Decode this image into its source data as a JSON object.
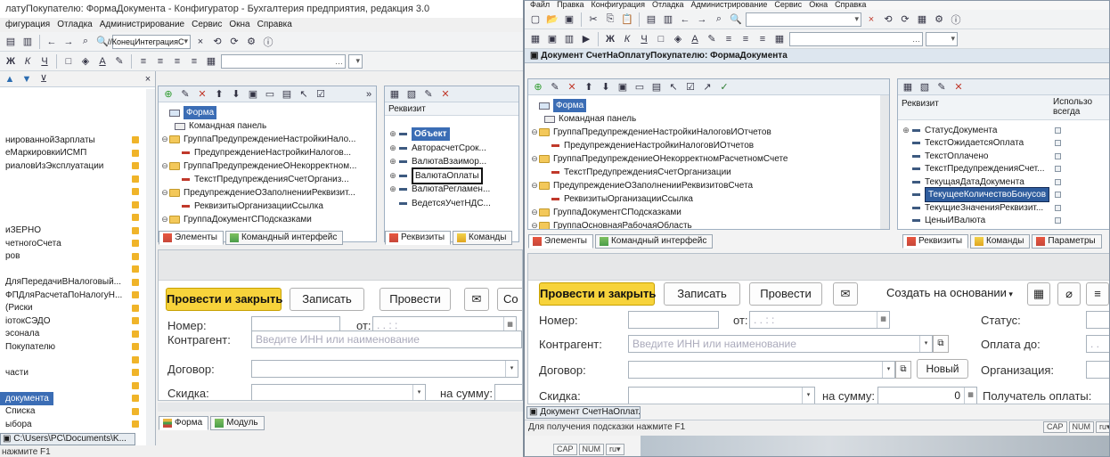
{
  "left_window": {
    "title": "латуПокупателю: ФормаДокумента - Конфигуратор - Бухгалтерия предприятия, редакция 3.0",
    "menu": [
      "фигурация",
      "Отладка",
      "Администрирование",
      "Сервис",
      "Окна",
      "Справка"
    ],
    "toolbar_combo": "//КонецИнтеграцияС",
    "sidebar_items": [
      "нированнойЗарплаты",
      "еМаркировкиИСМП",
      "риаловИзЭксплуатации",
      "",
      "",
      "",
      "",
      "иЗЕРНО",
      "четногоСчета",
      "ров",
      "",
      "ДляПередачиВНалоговый...",
      "ФПДляРасчетаПоНалогуН...",
      "(Риски",
      "іотокСЭДО",
      "эсонала",
      "Покупателю",
      "",
      "части",
      "",
      "документа",
      "Списка",
      "ыбора"
    ],
    "taskbar_path": "C:\\Users\\PC\\Documents\\K...",
    "status": "нажмите F1"
  },
  "left_editor": {
    "tree": [
      {
        "label": "Форма",
        "kind": "form",
        "sel": true
      },
      {
        "label": "Командная панель",
        "kind": "cmd"
      },
      {
        "label": "ГруппаПредупреждениеНастройкиНало...",
        "kind": "folder"
      },
      {
        "label": "ПредупреждениеНастройкиНалогов...",
        "kind": "item"
      },
      {
        "label": "ГруппаПредупреждениеОНекорректном...",
        "kind": "folder"
      },
      {
        "label": "ТекстПредупрежденияСчетОрганиз...",
        "kind": "item"
      },
      {
        "label": "ПредупреждениеОЗаполненииРеквизит...",
        "kind": "folder"
      },
      {
        "label": "РеквизитыОрганизацииСсылка",
        "kind": "item"
      },
      {
        "label": "ГруппаДокументСПодсказками",
        "kind": "folder"
      }
    ],
    "tabs": [
      "Элементы",
      "Командный интерфейс"
    ],
    "attrs_header": "Реквизит",
    "attrs": [
      "Объект",
      "АвторасчетСрок...",
      "ВалютаВзаимор...",
      "ВалютаОплаты",
      "ВалютаРегламен...",
      "ВедетсяУчетНДС..."
    ],
    "attr_tabs": [
      "Реквизиты",
      "Команды"
    ],
    "bottom_tabs": [
      "Форма",
      "Модуль"
    ]
  },
  "left_form": {
    "btn_post_close": "Провести и закрыть",
    "btn_write": "Записать",
    "btn_post": "Провести",
    "btn_partial": "Со",
    "label_number": "Номер:",
    "label_from": "от:",
    "date_value": ". .    : :",
    "label_counterparty": "Контрагент:",
    "counterparty_placeholder": "Введите ИНН или наименование",
    "label_contract": "Договор:",
    "label_discount": "Скидка:",
    "label_sum": "на сумму:"
  },
  "right_window": {
    "menu": [
      "Файл",
      "Правка",
      "Конфигурация",
      "Отладка",
      "Администрирование",
      "Сервис",
      "Окна",
      "Справка"
    ],
    "doc_title": "Документ СчетНаОплатуПокупателю: ФормаДокумента",
    "tree": [
      {
        "label": "Форма",
        "kind": "form",
        "sel": true
      },
      {
        "label": "Командная панель",
        "kind": "cmd"
      },
      {
        "label": "ГруппаПредупреждениеНастройкиНалоговИОтчетов",
        "kind": "folder"
      },
      {
        "label": "ПредупреждениеНастройкиНалоговИОтчетов",
        "kind": "item"
      },
      {
        "label": "ГруппаПредупреждениеОНекорректномРасчетномСчете",
        "kind": "folder"
      },
      {
        "label": "ТекстПредупрежденияСчетОрганизации",
        "kind": "item"
      },
      {
        "label": "ПредупреждениеОЗаполненииРеквизитовСчета",
        "kind": "folder"
      },
      {
        "label": "РеквизитыОрганизацииСсылка",
        "kind": "item"
      },
      {
        "label": "ГруппаДокументСПодсказками",
        "kind": "folder"
      },
      {
        "label": "ГруппаОсновнаяРабочаяОбласть",
        "kind": "folder"
      }
    ],
    "tabs": [
      "Элементы",
      "Командный интерфейс"
    ],
    "attrs_header": "Реквизит",
    "attrs_header2": "Использо всегда",
    "attrs": [
      "СтатусДокумента",
      "ТекстОжидаетсяОплата",
      "ТекстОплачено",
      "ТекстПредупрежденияСчет...",
      "ТекущаяДатаДокумента",
      "ТекущееКоличествоБонусов",
      "ТекущиеЗначенияРеквизит...",
      "ЦеныИВалюта"
    ],
    "attr_tabs": [
      "Реквизиты",
      "Команды",
      "Параметры"
    ],
    "btn_post_close": "Провести и закрыть",
    "btn_write": "Записать",
    "btn_post": "Провести",
    "btn_create_based": "Создать на основании",
    "label_number": "Номер:",
    "label_from": "от:",
    "date_value": ". .    : :",
    "label_status": "Статус:",
    "label_counterparty": "Контрагент:",
    "counterparty_placeholder": "Введите ИНН или наименование",
    "label_pay_until": "Оплата до:",
    "pay_until_value": ". .",
    "label_contract": "Договор:",
    "btn_new": "Новый",
    "label_org": "Организация:",
    "label_discount": "Скидка:",
    "label_sum": "на сумму:",
    "sum_value": "0",
    "label_recipient": "Получатель оплаты:",
    "task_item": "Документ СчетНаОплат...",
    "status_hint": "Для получения подсказки нажмите F1",
    "caps": "CAP",
    "num": "NUM",
    "lang": "ru"
  }
}
